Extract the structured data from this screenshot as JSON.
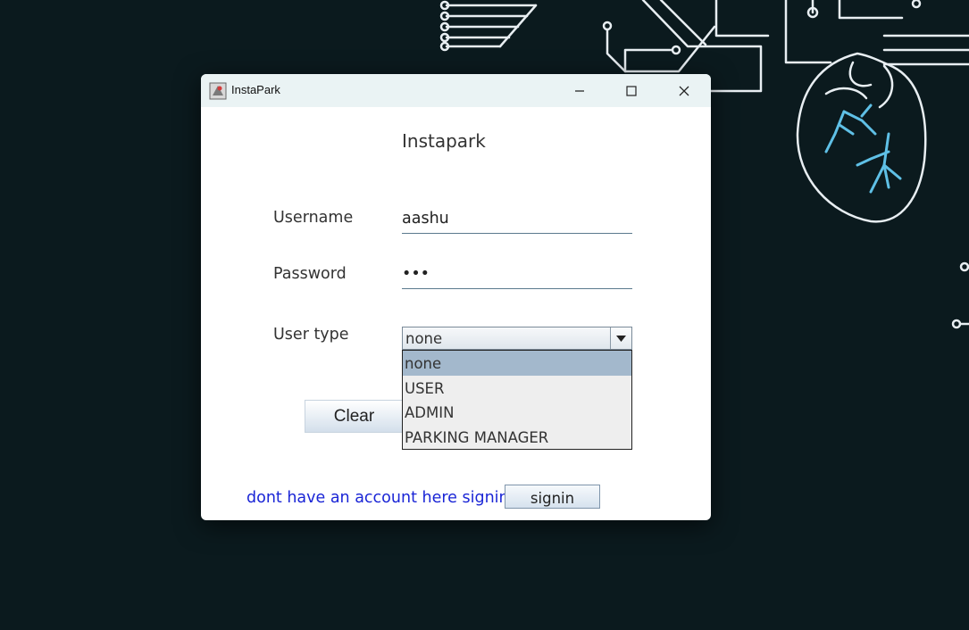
{
  "window": {
    "title": "InstaPark"
  },
  "form": {
    "heading": "Instapark",
    "username_label": "Username",
    "username_value": "aashu",
    "password_label": "Password",
    "password_value": "•••",
    "usertype_label": "User type",
    "usertype_selected": "none",
    "usertype_options": [
      "none",
      "USER",
      "ADMIN",
      "PARKING MANAGER"
    ],
    "clear_label": "Clear",
    "signup_link": "dont have an account here signin",
    "signin_label": "signin"
  },
  "colors": {
    "wallpaper": "#0b1a1e",
    "circuit": "#e8eef2",
    "vessels": "#5fc0e6",
    "link": "#1a25d6",
    "dropdown_selected": "#a3b8cc"
  }
}
